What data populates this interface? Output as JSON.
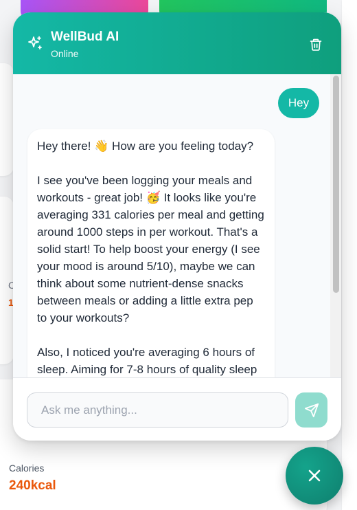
{
  "background": {
    "stat": {
      "label": "Calories",
      "value": "240kcal"
    },
    "peek_label_letter": "C",
    "peek_value_digit": "1"
  },
  "chat": {
    "header": {
      "title": "WellBud AI",
      "status": "Online",
      "icon": "sparkle-icon",
      "trash_icon": "trash-icon"
    },
    "messages": {
      "user": "Hey",
      "ai_paragraphs": [
        "Hey there! 👋 How are you feeling today?",
        "I see you've been logging your meals and workouts - great job! 🥳 It looks like you're averaging 331 calories per meal and getting around 1000 steps in per workout. That's a solid start! To help boost your energy (I see your mood is around 5/10), maybe we can think about some nutrient-dense snacks between meals or adding a little extra pep to your workouts?",
        "Also, I noticed you're averaging 6 hours of sleep. Aiming for 7-8 hours of quality sleep"
      ]
    },
    "input": {
      "placeholder": "Ask me anything...",
      "value": ""
    },
    "send_icon": "send-icon"
  },
  "fab": {
    "icon": "close-icon"
  },
  "colors": {
    "accent": "#14b8a6",
    "header_end": "#0f9f7d",
    "calorie_orange": "#ea580c",
    "send_disabled": "#8fdcce"
  }
}
